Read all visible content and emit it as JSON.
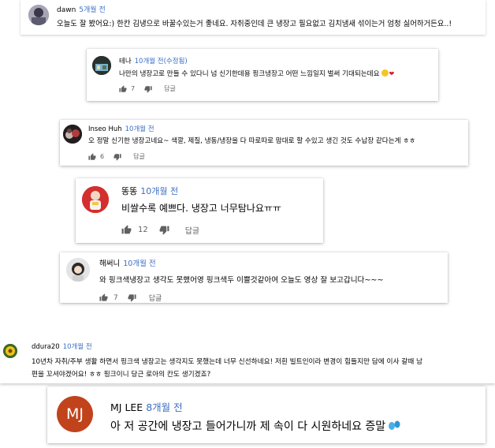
{
  "comments": [
    {
      "author": "dawn",
      "time": "5개월 전",
      "text": "오늘도 잘 봤어요:) 한칸 김냉으로 바꿀수있는거 좋네요. 자취중인데 큰 냉장고 필요없고 김치냄새 섞이는거 엄청 싫어하거든요..!"
    },
    {
      "author": "테나",
      "time": "10개월 전(수정됨)",
      "text": "나만의 냉장고로 만들 수 있다니 넘 신기한데용 핑크냉장고 어떤 느낌일지 벌써 기대되는데요",
      "likes": "7",
      "reply": "답글"
    },
    {
      "author": "Inseo Huh",
      "time": "10개월 전",
      "text": "오 정말 신기한 냉장고네요~ 색깔, 제질, 냉동/냉장을 다 따로따로 맘대로 할 수있고 생긴 것도 수납장 같다는게 ㅎㅎ",
      "likes": "6",
      "reply": "답글"
    },
    {
      "author": "똥똥",
      "time": "10개월 전",
      "text": "비쌀수록 예쁘다. 냉장고 너무탐나요ㅠㅠ",
      "likes": "12",
      "reply": "답글"
    },
    {
      "author": "해써니",
      "time": "10개월 전",
      "text": "와 핑크색냉장고 생각도 못했어영 핑크색두 이쁠것같아여 오늘도 영상 잘 보고갑니다~~~",
      "likes": "7",
      "reply": "답글"
    },
    {
      "author": "ddura20",
      "time": "10개월 전",
      "text_line1": "10년차 자취/주부 생활 하면서 핑크색 냉장고는 생각지도 못했는데 너무 신선하네요! 저흰 빌트인이라 변경이 힘들지만 담에 이사 갈때 남",
      "text_line2": "편을 꼬셔야겠어요! ㅎㅎ 핑크이니 당근 로아의 칸도 생기겠죠?"
    },
    {
      "author": "MJ LEE",
      "time": "8개월 전",
      "avatar_initials": "MJ",
      "text": "아 저 공간에 냉장고 들어가니까 제 속이 다 시원하네요 증말"
    }
  ],
  "colors": {
    "time_link": "#3b6fc4",
    "mjlee_avatar": "#c0431c",
    "ddong_avatar": "#d32f2f"
  }
}
